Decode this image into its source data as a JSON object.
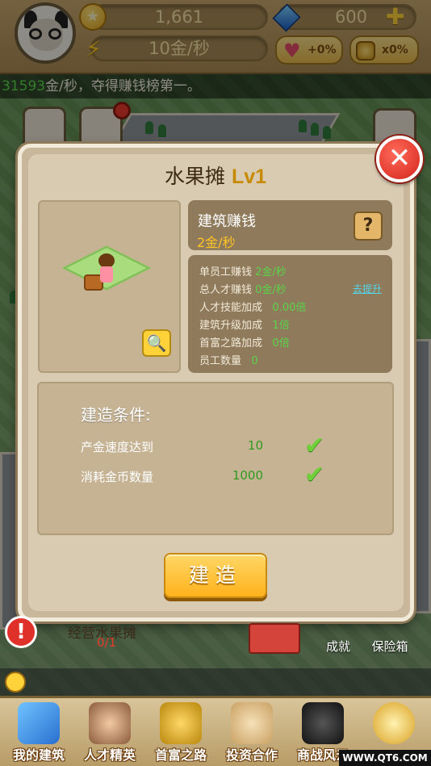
{
  "hud": {
    "coins": "1,661",
    "income": "10金/秒",
    "gems": "600",
    "heart_bonus": "+0%",
    "coin_bonus": "x0%"
  },
  "ticker": {
    "number": "31593",
    "text": "金/秒，夺得赚钱榜第一。"
  },
  "dialog": {
    "title": "水果摊",
    "level": "Lv1",
    "earn_title": "建筑赚钱",
    "earn_value": "2金/秒",
    "help": "?",
    "stats": [
      {
        "label": "单员工赚钱",
        "value": "2金/秒"
      },
      {
        "label": "总人才赚钱",
        "value": "0金/秒"
      },
      {
        "label": "人才技能加成",
        "value": "0.00倍"
      },
      {
        "label": "建筑升级加成",
        "value": "1倍"
      },
      {
        "label": "首富之路加成",
        "value": "0倍"
      },
      {
        "label": "员工数量",
        "value": "0"
      }
    ],
    "upgrade_link": "去提升",
    "conditions_title": "建造条件:",
    "conditions": [
      {
        "label": "产金速度达到",
        "value": "10"
      },
      {
        "label": "消耗金币数量",
        "value": "1000"
      }
    ],
    "build_button": "建造"
  },
  "map": {
    "building_name": "经营水果摊",
    "building_count": "0/1",
    "achievement": "成就",
    "safe": "保险箱"
  },
  "nav": [
    {
      "label": "我的建筑"
    },
    {
      "label": "人才精英"
    },
    {
      "label": "首富之路"
    },
    {
      "label": "投资合作"
    },
    {
      "label": "商战风云"
    },
    {
      "label": ""
    }
  ],
  "watermark": "WWW.QT6.COM",
  "colors": {
    "accent_gold": "#ffc426",
    "value_green": "#5bd44a",
    "close_red": "#d4251a"
  }
}
